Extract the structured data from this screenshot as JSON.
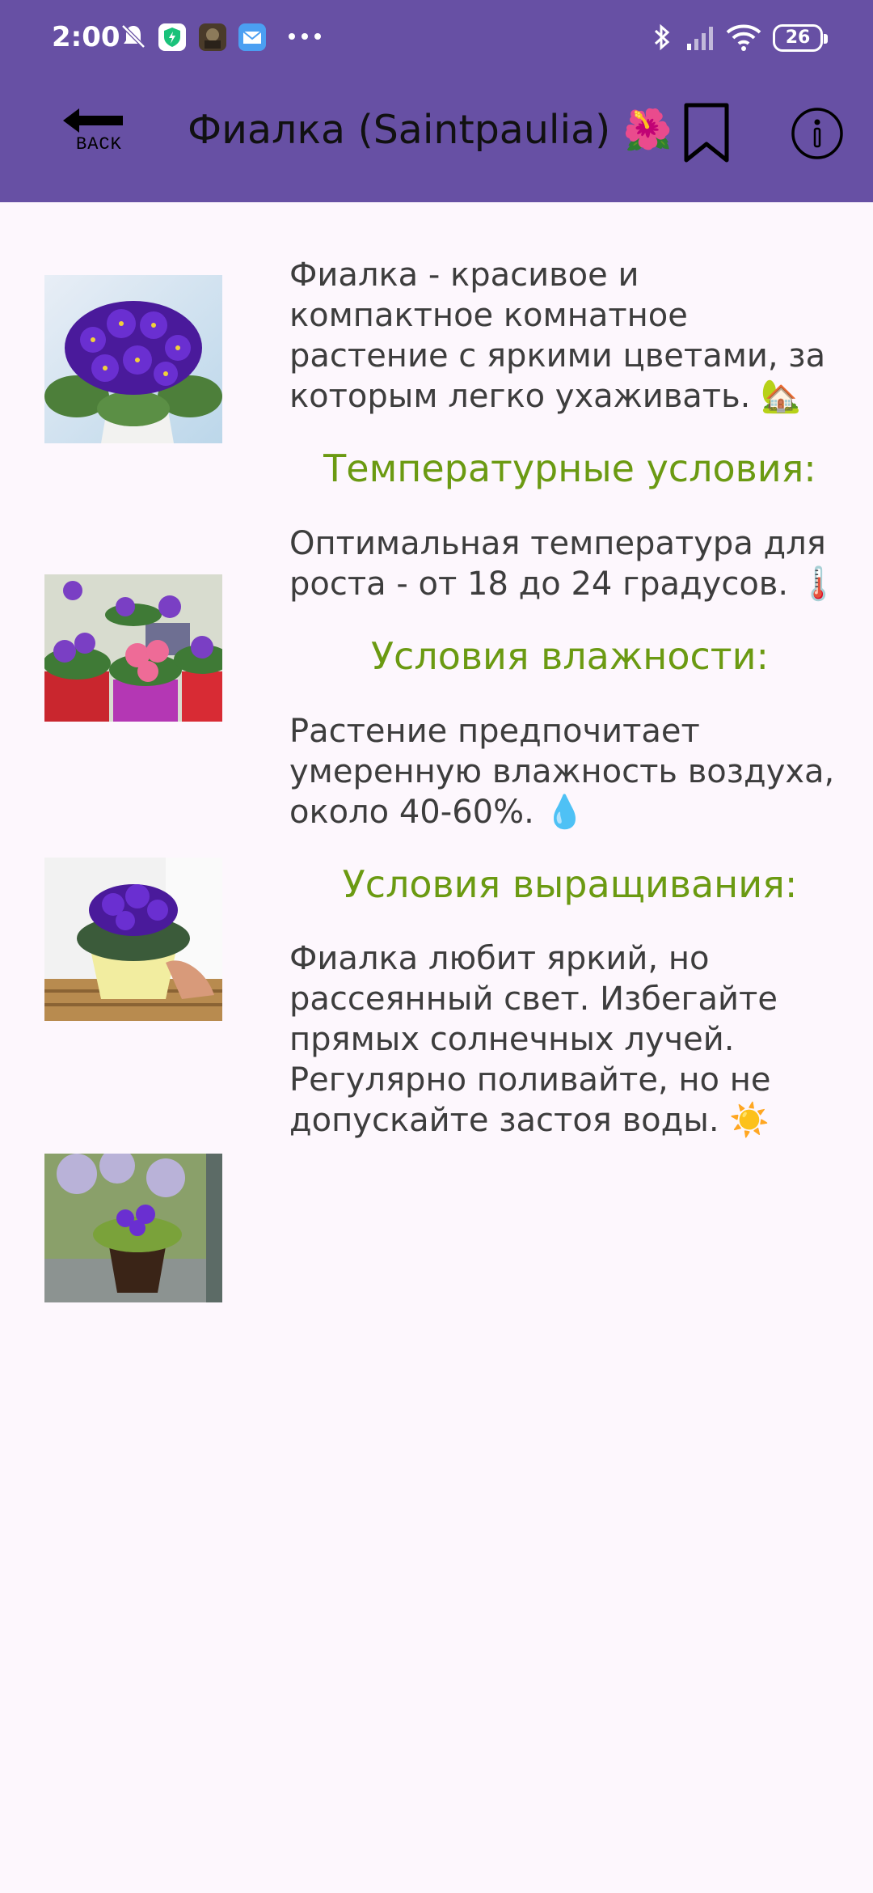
{
  "status_bar": {
    "time": "2:00",
    "battery": "26",
    "icons": [
      "mute-icon",
      "shield-app-icon",
      "game-app-icon",
      "mail-app-icon",
      "more-dots-icon",
      "bluetooth-icon",
      "signal-icon",
      "wifi-icon",
      "battery-icon"
    ]
  },
  "toolbar": {
    "back_label": "BACK",
    "title": "Фиалка (Saintpaulia) 🌺",
    "bookmark_icon": "bookmark-icon",
    "info_icon": "info-icon"
  },
  "colors": {
    "app_bar": "#6750a4",
    "background": "#fdf7fd",
    "section_title": "#6b9a12",
    "body_text": "#3d3d3d"
  },
  "content": {
    "intro": "Фиалка - красивое и компактное комнатное растение с яркими цветами, за  которым легко ухаживать. 🏡",
    "sections": [
      {
        "title": "Температурные условия:",
        "text": "Оптимальная температура для роста - от 18 до 24 градусов. 🌡️"
      },
      {
        "title": "Условия влажности:",
        "text": "Растение предпочитает умеренную влажность воздуха, около 40-60%. 💧"
      },
      {
        "title": "Условия выращивания:",
        "text": "Фиалка любит яркий, но рассеянный свет. Избегайте прямых солнечных лучей. Регулярно поливайте, но не допускайте застоя воды. ☀️"
      }
    ]
  }
}
